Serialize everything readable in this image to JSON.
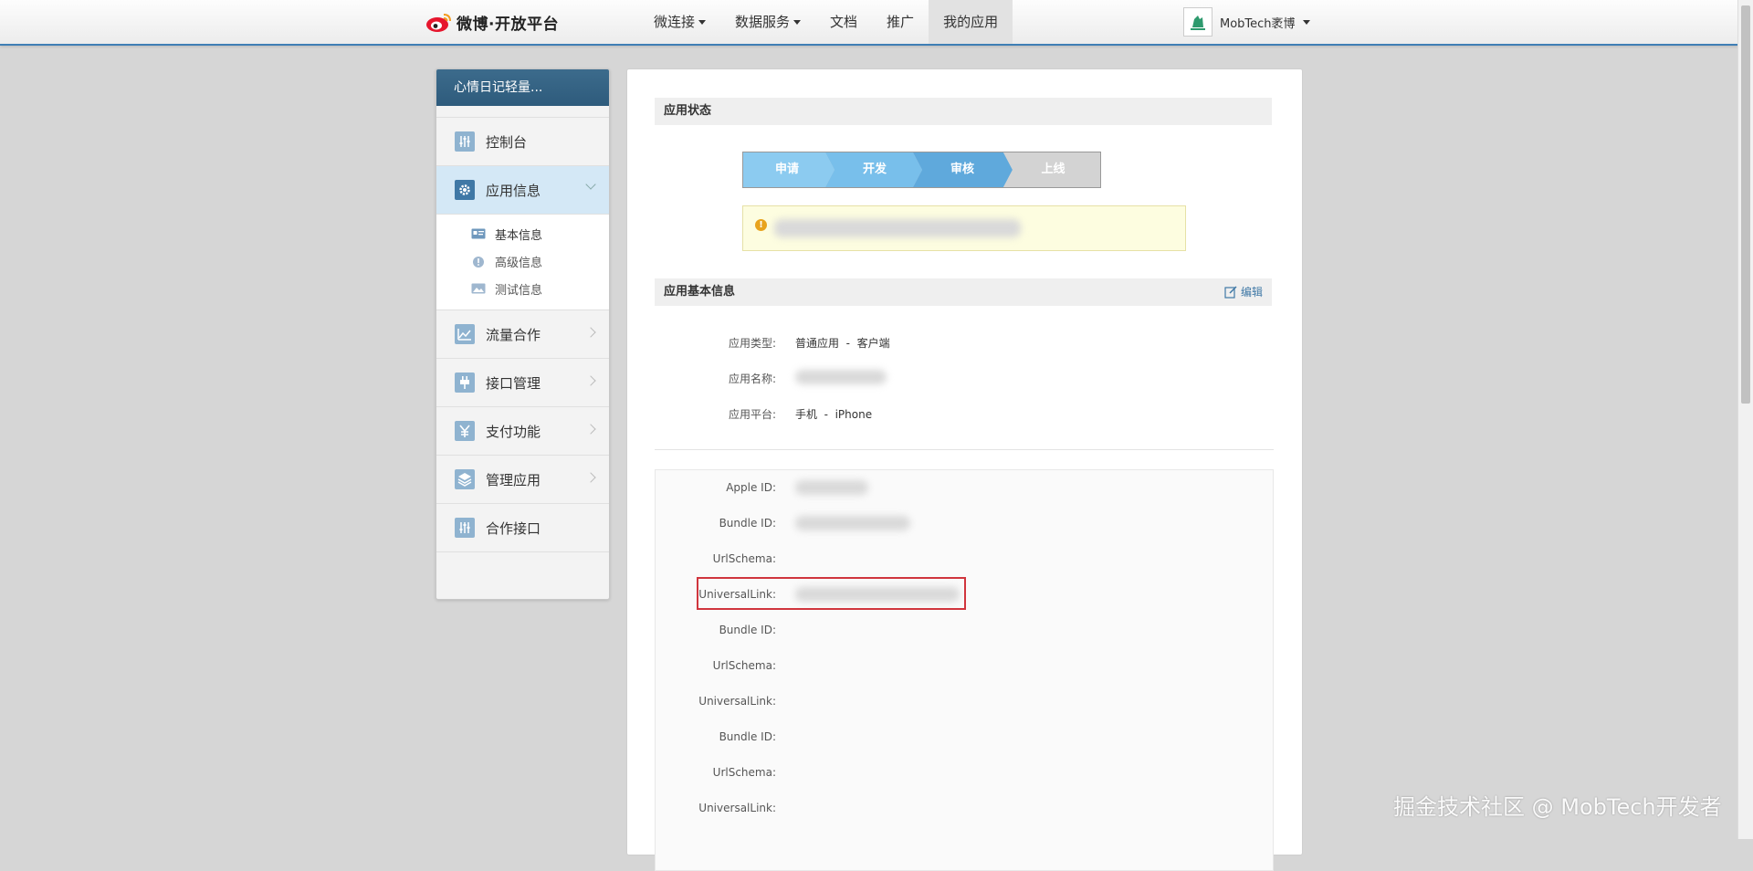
{
  "brand": {
    "logo_text": "微博·开放平台"
  },
  "nav": {
    "items": [
      {
        "label": "微连接",
        "has_caret": true
      },
      {
        "label": "数据服务",
        "has_caret": true
      },
      {
        "label": "文档",
        "has_caret": false
      },
      {
        "label": "推广",
        "has_caret": false
      },
      {
        "label": "我的应用",
        "has_caret": false,
        "active": true
      }
    ]
  },
  "user": {
    "name": "MobTech袤博"
  },
  "sidebar": {
    "header": "心情日记轻量...",
    "items": [
      {
        "label": "控制台",
        "icon": "sliders-icon"
      },
      {
        "label": "应用信息",
        "icon": "gear-icon",
        "active": true
      },
      {
        "label": "流量合作",
        "icon": "chart-icon"
      },
      {
        "label": "接口管理",
        "icon": "plug-icon"
      },
      {
        "label": "支付功能",
        "icon": "yen-icon"
      },
      {
        "label": "管理应用",
        "icon": "layers-icon"
      },
      {
        "label": "合作接口",
        "icon": "sliders-icon"
      }
    ],
    "sub_items": [
      {
        "label": "基本信息",
        "icon": "card-icon"
      },
      {
        "label": "高级信息",
        "icon": "info-icon"
      },
      {
        "label": "测试信息",
        "icon": "image-icon"
      }
    ]
  },
  "status": {
    "title": "应用状态",
    "steps": [
      "申请",
      "开发",
      "审核",
      "上线"
    ],
    "current_step": 3
  },
  "basic": {
    "title": "应用基本信息",
    "edit_label": "编辑",
    "rows": [
      {
        "label": "应用类型:",
        "value": "普通应用  -  客户端"
      },
      {
        "label": "应用名称:",
        "value": ""
      },
      {
        "label": "应用平台:",
        "value": "手机  -  iPhone"
      }
    ]
  },
  "ios": {
    "rows": [
      {
        "label": "Apple ID:"
      },
      {
        "label": "Bundle ID:"
      },
      {
        "label": "UrlSchema:"
      },
      {
        "label": "UniversalLink:"
      },
      {
        "label": "Bundle ID:"
      },
      {
        "label": "UrlSchema:"
      },
      {
        "label": "UniversalLink:"
      },
      {
        "label": "Bundle ID:"
      },
      {
        "label": "UrlSchema:"
      },
      {
        "label": "UniversalLink:"
      }
    ]
  },
  "watermark": "掘金技术社区 @ MobTech开发者",
  "colors": {
    "accent": "#3f78a6",
    "highlight": "#d0353d",
    "step_done": "#6fb6e6",
    "step_pending": "#d6d6d6"
  }
}
